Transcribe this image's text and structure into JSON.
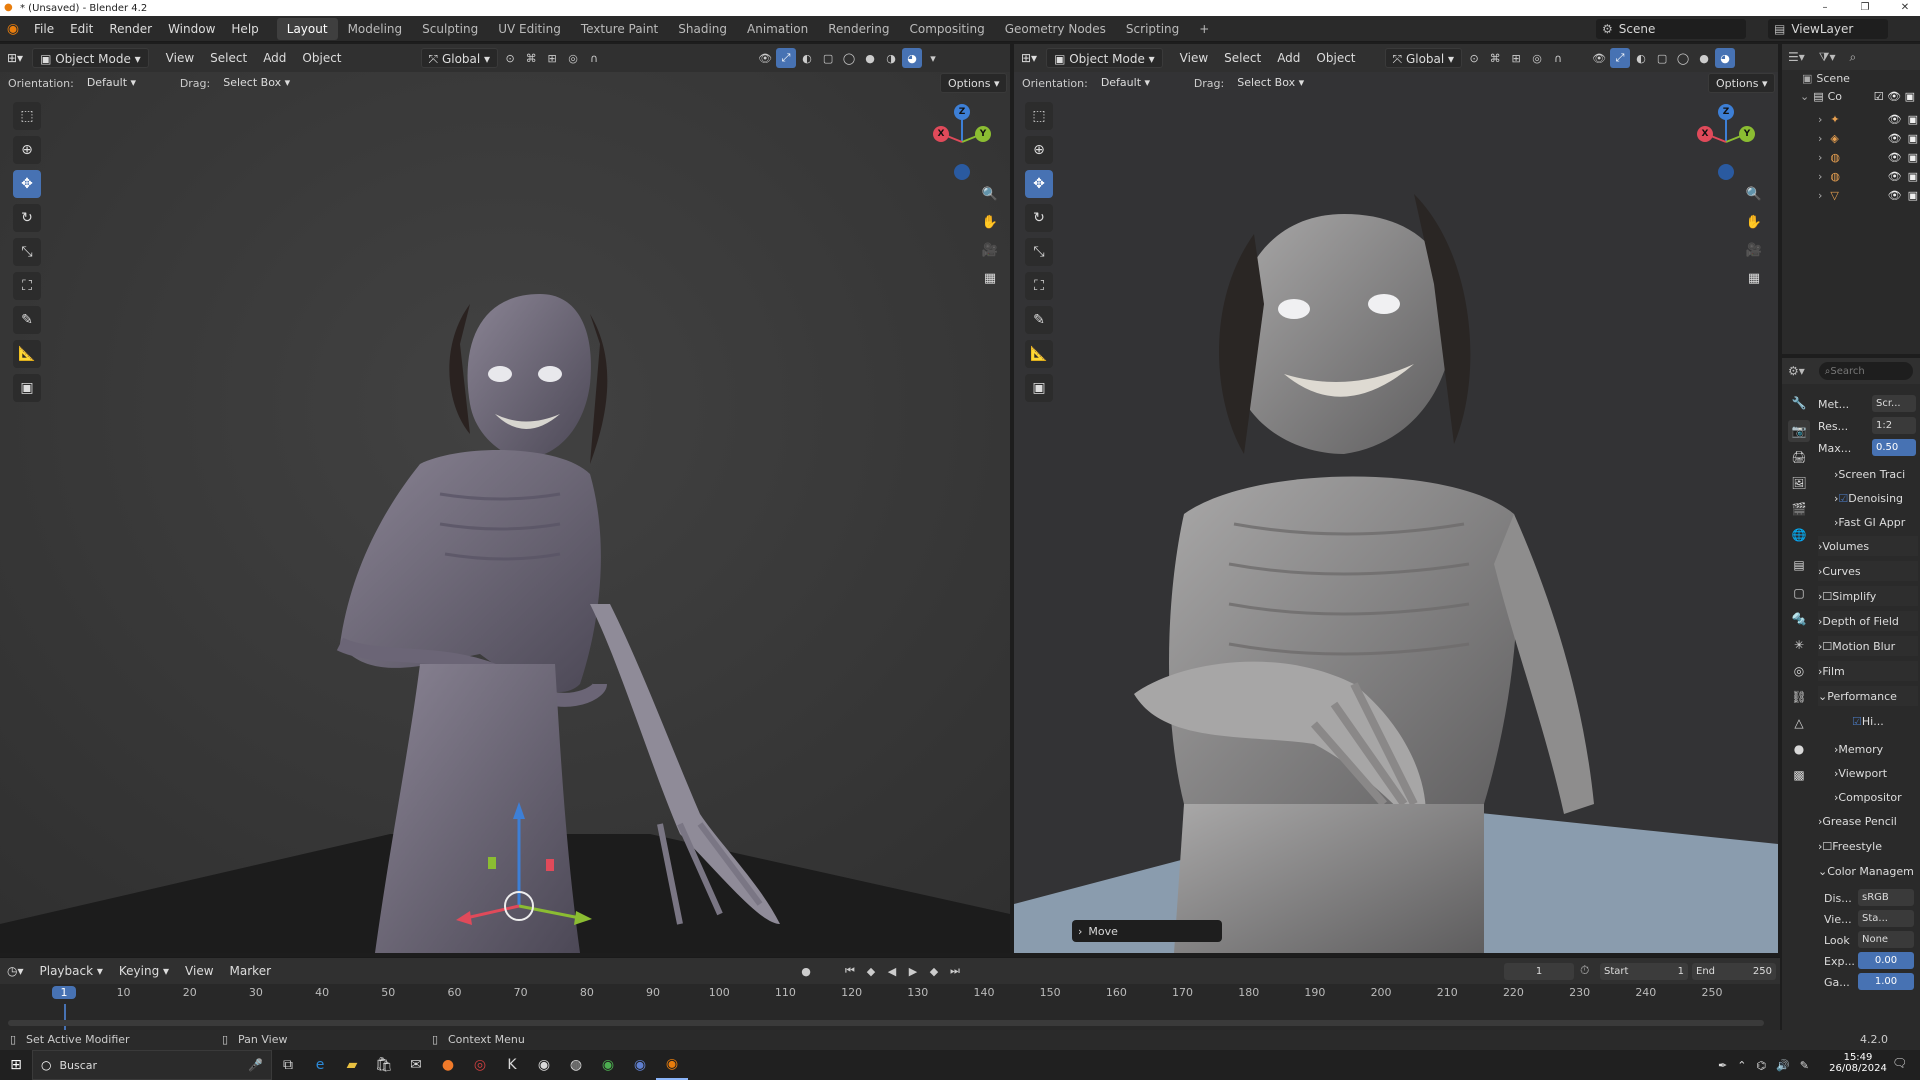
{
  "window": {
    "title": "* (Unsaved) - Blender 4.2",
    "minimize": "–",
    "maximize": "❐",
    "close": "✕"
  },
  "menus": [
    "File",
    "Edit",
    "Render",
    "Window",
    "Help"
  ],
  "workspaces": [
    {
      "label": "Layout",
      "active": true
    },
    {
      "label": "Modeling"
    },
    {
      "label": "Sculpting"
    },
    {
      "label": "UV Editing"
    },
    {
      "label": "Texture Paint"
    },
    {
      "label": "Shading"
    },
    {
      "label": "Animation"
    },
    {
      "label": "Rendering"
    },
    {
      "label": "Compositing"
    },
    {
      "label": "Geometry Nodes"
    },
    {
      "label": "Scripting"
    }
  ],
  "add_workspace": "+",
  "scene": {
    "label": "Scene",
    "view_layer": "ViewLayer"
  },
  "viewport_left": {
    "mode": "Object Mode",
    "menus": [
      "View",
      "Select",
      "Add",
      "Object"
    ],
    "transform": "Global",
    "orientation_label": "Orientation:",
    "orientation": "Default",
    "drag_label": "Drag:",
    "drag": "Select Box",
    "options": "Options"
  },
  "viewport_right": {
    "mode": "Object Mode",
    "menus": [
      "View",
      "Select",
      "Add",
      "Object"
    ],
    "transform": "Global",
    "orientation_label": "Orientation:",
    "orientation": "Default",
    "drag_label": "Drag:",
    "drag": "Select Box",
    "options": "Options",
    "last_op": "Move"
  },
  "gizmo": {
    "x": "X",
    "y": "Y",
    "z": "Z"
  },
  "colors": {
    "accent": "#4772b3",
    "x_axis": "#e04a5a",
    "y_axis": "#8bbd32",
    "z_axis": "#3d7fd6",
    "header": "#303030",
    "panel": "#2a2a2a"
  },
  "outliner": {
    "title": "Scene",
    "collection": "Co"
  },
  "properties": {
    "search_placeholder": "Search",
    "fields": [
      {
        "label": "Met...",
        "value": "Scr..."
      },
      {
        "label": "Res...",
        "value": "1:2"
      },
      {
        "label": "Max...",
        "value": "0.50"
      }
    ],
    "subs1": [
      "Screen Traci",
      "Denoising",
      "Fast GI Appr"
    ],
    "panels": [
      "Volumes",
      "Curves",
      "Simplify",
      "Depth of Field",
      "Motion Blur",
      "Film",
      "Performance"
    ],
    "perf_check": "Hi...",
    "perf_subs": [
      "Memory",
      "Viewport",
      "Compositor"
    ],
    "panels2": [
      "Grease Pencil",
      "Freestyle",
      "Color Managem"
    ],
    "cm_fields": [
      {
        "label": "Dis...",
        "value": "sRGB"
      },
      {
        "label": "Vie...",
        "value": "Sta..."
      },
      {
        "label": "Look",
        "value": "None"
      },
      {
        "label": "Exp...",
        "value": "0.00"
      },
      {
        "label": "Ga...",
        "value": "1.00"
      }
    ]
  },
  "timeline": {
    "menus": [
      "Playback",
      "Keying",
      "View",
      "Marker"
    ],
    "current_frame": "1",
    "start_label": "Start",
    "start": "1",
    "end_label": "End",
    "end": "250",
    "ticks": [
      "1",
      "10",
      "20",
      "30",
      "40",
      "50",
      "60",
      "70",
      "80",
      "90",
      "100",
      "110",
      "120",
      "130",
      "140",
      "150",
      "160",
      "170",
      "180",
      "190",
      "200",
      "210",
      "220",
      "230",
      "240",
      "250"
    ]
  },
  "status": {
    "left": "Set Active Modifier",
    "middle": "Pan View",
    "right": "Context Menu",
    "version": "4.2.0"
  },
  "taskbar": {
    "search": "Buscar",
    "time": "15:49",
    "date": "26/08/2024"
  }
}
